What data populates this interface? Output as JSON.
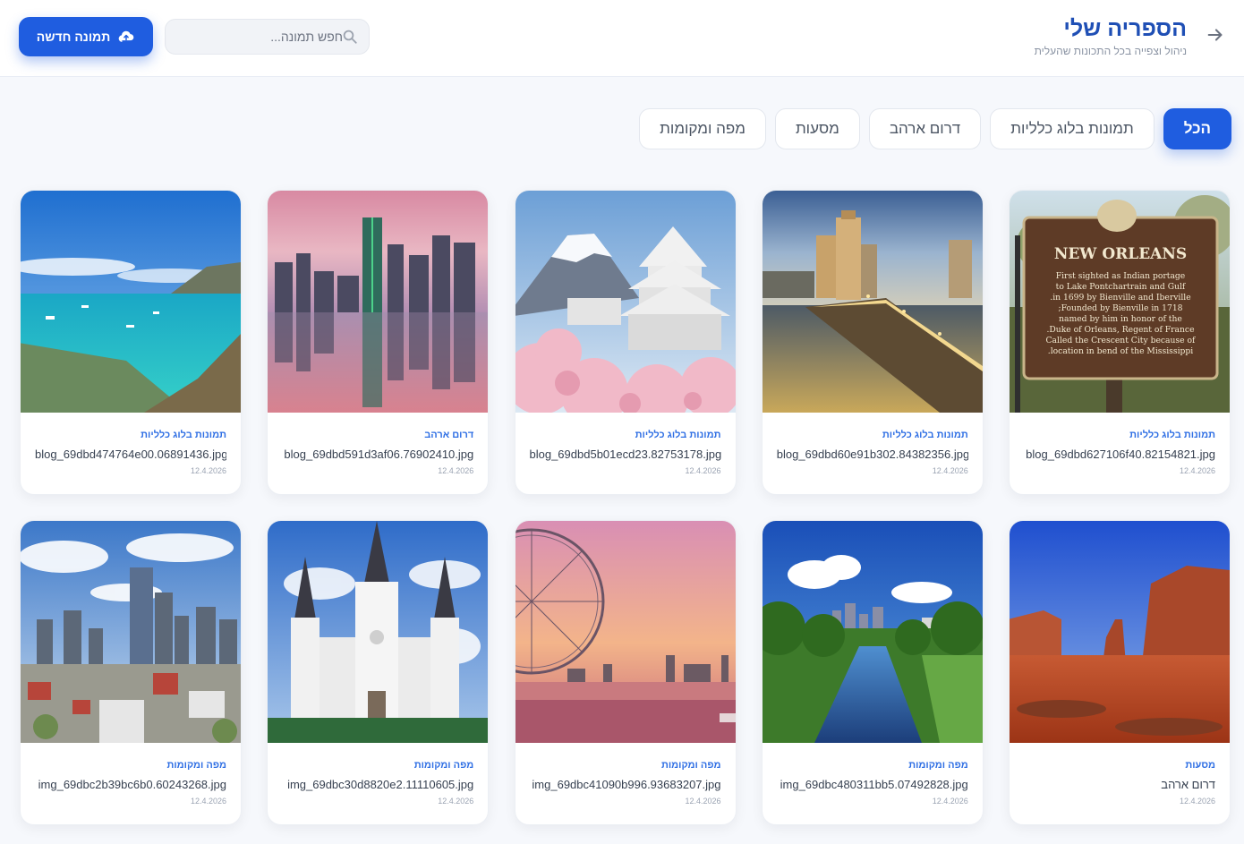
{
  "header": {
    "title": "הספריה שלי",
    "subtitle": "ניהול וצפייה בכל התכונות שהעלית",
    "back_icon": "arrow-right-icon",
    "new_button_label": "תמונה חדשה",
    "new_button_icon": "cloud-upload-icon"
  },
  "search": {
    "placeholder": "חפש תמונה...",
    "value": "",
    "icon": "search-icon"
  },
  "tabs": [
    {
      "label": "הכל",
      "active": true
    },
    {
      "label": "תמונות בלוג כלליות",
      "active": false
    },
    {
      "label": "דרום ארהב",
      "active": false
    },
    {
      "label": "מסעות",
      "active": false
    },
    {
      "label": "מפה ומקומות",
      "active": false
    }
  ],
  "cards": [
    {
      "category": "תמונות בלוג כלליות",
      "filename": "blog_69dbd627106f40.82154821.jpg",
      "date": "12.4.2026",
      "image": "new-orleans-historic-sign"
    },
    {
      "category": "תמונות בלוג כלליות",
      "filename": "blog_69dbd60e91b302.84382356.jpg",
      "date": "12.4.2026",
      "image": "new-orleans-riverfront-night"
    },
    {
      "category": "תמונות בלוג כלליות",
      "filename": "blog_69dbd5b01ecd23.82753178.jpg",
      "date": "12.4.2026",
      "image": "japan-castle-mount-fuji"
    },
    {
      "category": "דרום ארהב",
      "filename": "blog_69dbd591d3af06.76902410.jpg",
      "date": "12.4.2026",
      "image": "dallas-skyline-reflection"
    },
    {
      "category": "תמונות בלוג כלליות",
      "filename": "blog_69dbd474764e00.06891436.jpg",
      "date": "12.4.2026",
      "image": "turquoise-bay-coast"
    },
    {
      "category": "מסעות",
      "filename": "דרום ארהב",
      "date": "12.4.2026",
      "image": "monument-valley"
    },
    {
      "category": "מפה ומקומות",
      "filename": "img_69dbc480311bb5.07492828.jpg",
      "date": "12.4.2026",
      "image": "houston-bayou-park"
    },
    {
      "category": "מפה ומקומות",
      "filename": "img_69dbc41090b996.93683207.jpg",
      "date": "12.4.2026",
      "image": "london-eye-sunset"
    },
    {
      "category": "מפה ומקומות",
      "filename": "img_69dbc30d8820e2.11110605.jpg",
      "date": "12.4.2026",
      "image": "st-louis-cathedral"
    },
    {
      "category": "מפה ומקומות",
      "filename": "img_69dbc2b39bc6b0.60243268.jpg",
      "date": "12.4.2026",
      "image": "dallas-downtown-aerial"
    }
  ],
  "sign_text": {
    "title": "NEW ORLEANS",
    "body": [
      "First sighted as Indian portage",
      "to Lake Pontchartrain and Gulf",
      "in 1699 by Bienville and Iberville.",
      "Founded by Bienville in 1718;",
      "named by him in honor of the",
      "Duke of Orleans, Regent of France.",
      "Called the Crescent City because of",
      "location in bend of the Mississippi."
    ]
  },
  "colors": {
    "accent": "#1f5de0",
    "title": "#1f4fb5",
    "category": "#2f6fe4"
  }
}
